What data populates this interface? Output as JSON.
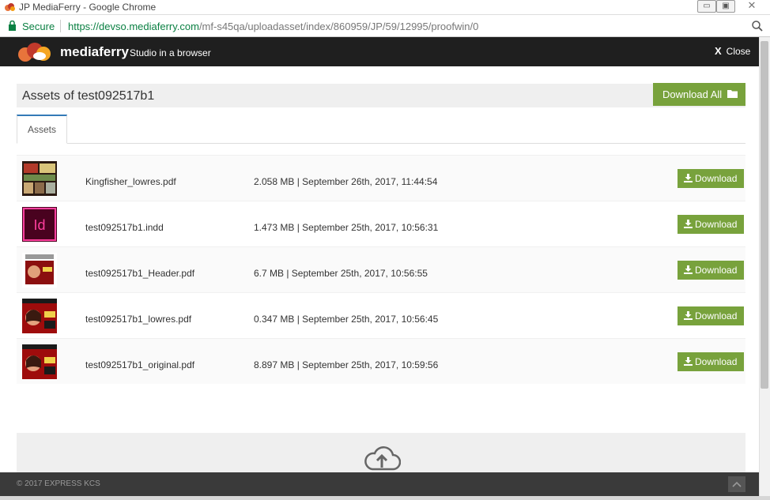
{
  "window": {
    "title": "JP MediaFerry - Google Chrome",
    "controls": {
      "minimize": "▭",
      "maximize": "▣",
      "close": "✕"
    }
  },
  "addressbar": {
    "secure_label": "Secure",
    "url_host": "https://devso.mediaferry.com",
    "url_path": "/mf-s45qa/uploadasset/index/860959/JP/59/12995/proofwin/0"
  },
  "header": {
    "brand": "mediaferry",
    "tagline": "Studio in a browser",
    "close_label": "Close",
    "close_glyph": "X"
  },
  "panel": {
    "title": "Assets of test092517b1",
    "download_all_label": "Download All"
  },
  "tabs": [
    {
      "label": "Assets",
      "active": true
    }
  ],
  "assets": [
    {
      "name": "Kingfisher_lowres.pdf",
      "meta": "2.058 MB | September 26th, 2017, 11:44:54",
      "thumb": "pdf-photo",
      "download_label": "Download"
    },
    {
      "name": "test092517b1.indd",
      "meta": "1.473 MB | September 25th, 2017, 10:56:31",
      "thumb": "indesign",
      "download_label": "Download"
    },
    {
      "name": "test092517b1_Header.pdf",
      "meta": "6.7 MB | September 25th, 2017, 10:56:55",
      "thumb": "header-pdf",
      "download_label": "Download"
    },
    {
      "name": "test092517b1_lowres.pdf",
      "meta": "0.347 MB | September 25th, 2017, 10:56:45",
      "thumb": "magazine-pdf",
      "download_label": "Download"
    },
    {
      "name": "test092517b1_original.pdf",
      "meta": "8.897 MB | September 25th, 2017, 10:59:56",
      "thumb": "magazine-pdf",
      "download_label": "Download"
    }
  ],
  "footer": {
    "copyright": "© 2017 EXPRESS KCS"
  },
  "colors": {
    "accent_green": "#78a23c",
    "header_bg": "#1f1f1f",
    "footer_bg": "#3a3a3a",
    "indesign_pink": "#ff3f9e"
  },
  "icons": {
    "lock": "lock-icon",
    "zoom": "magnifier-icon",
    "folder": "folder-icon",
    "download": "download-icon",
    "upload": "cloud-upload-icon",
    "back_to_top": "chevron-up-icon"
  }
}
